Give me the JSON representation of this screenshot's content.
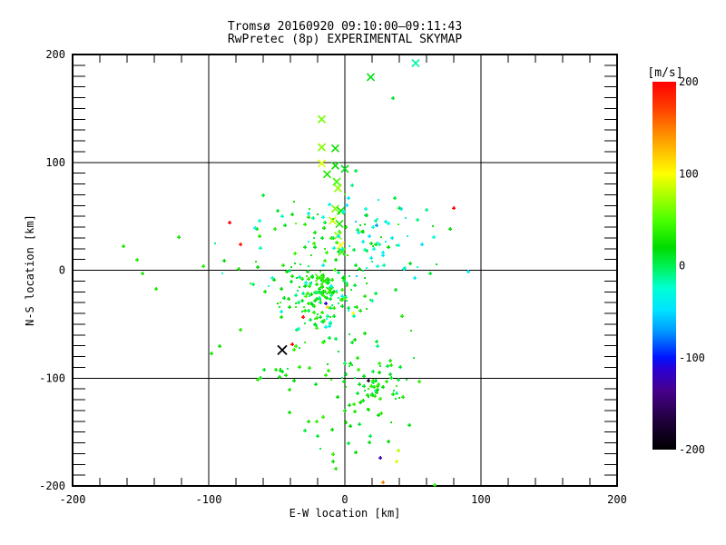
{
  "chart_data": {
    "type": "scatter",
    "title_line1": "Tromsø 20160920 09:10:00–09:11:43",
    "title_line2": "RwPretec (8p) EXPERIMENTAL SKYMAP",
    "xlabel": "E-W location [km]",
    "ylabel": "N-S location [km]",
    "xlim": [
      -200,
      200
    ],
    "ylim": [
      -200,
      200
    ],
    "xticks": [
      -200,
      -100,
      0,
      100,
      200
    ],
    "yticks": [
      -200,
      -100,
      0,
      100,
      200
    ],
    "x_minor_step": 20,
    "y_minor_step": 10,
    "grid": true,
    "axis_color": "#000000",
    "background": "#ffffff",
    "colorbar": {
      "label": "[m/s]",
      "min": -200,
      "max": 200,
      "ticks": [
        200,
        100,
        0,
        -100,
        -200
      ]
    },
    "colormap": [
      [
        0.0,
        "#000000"
      ],
      [
        0.08,
        "#20003c"
      ],
      [
        0.16,
        "#46008c"
      ],
      [
        0.22,
        "#2a00d4"
      ],
      [
        0.25,
        "#0014ff"
      ],
      [
        0.32,
        "#0096ff"
      ],
      [
        0.38,
        "#00e4ff"
      ],
      [
        0.44,
        "#00ffd2"
      ],
      [
        0.5,
        "#00f050"
      ],
      [
        0.55,
        "#00dc00"
      ],
      [
        0.62,
        "#46ff00"
      ],
      [
        0.72,
        "#d2ff00"
      ],
      [
        0.75,
        "#ffff00"
      ],
      [
        0.85,
        "#ff9600"
      ],
      [
        0.93,
        "#ff3c00"
      ],
      [
        1.0,
        "#ff0000"
      ]
    ],
    "markers": {
      "p": "small-plus-dot",
      "x": "cross",
      "X": "large-cross"
    },
    "points": [
      [
        52,
        192,
        -15,
        "x"
      ],
      [
        19,
        179,
        15,
        "x"
      ],
      [
        35,
        160,
        10,
        "p"
      ],
      [
        -17,
        140,
        60,
        "x"
      ],
      [
        -17,
        114,
        65,
        "x"
      ],
      [
        -7,
        113,
        25,
        "x"
      ],
      [
        -17,
        99,
        90,
        "x"
      ],
      [
        -7,
        97,
        20,
        "x"
      ],
      [
        0,
        94,
        15,
        "x"
      ],
      [
        -13,
        89,
        30,
        "x"
      ],
      [
        -6,
        82,
        45,
        "x"
      ],
      [
        -5,
        76,
        70,
        "x"
      ],
      [
        -7,
        57,
        60,
        "x"
      ],
      [
        -3,
        55,
        25,
        "x"
      ],
      [
        -1,
        54,
        -30,
        "p"
      ],
      [
        -9,
        46,
        85,
        "x"
      ],
      [
        -4,
        43,
        30,
        "x"
      ],
      [
        -5,
        32,
        70,
        "x"
      ],
      [
        -3,
        23,
        95,
        "x"
      ],
      [
        -2,
        17,
        40,
        "x"
      ],
      [
        -15,
        -10,
        30,
        "x"
      ],
      [
        -11,
        -19,
        25,
        "x"
      ],
      [
        -19,
        -7,
        40,
        "x"
      ],
      [
        -46,
        -74,
        -195,
        "X"
      ],
      [
        -39,
        -69,
        200,
        "p"
      ],
      [
        -31,
        -43,
        195,
        "p"
      ],
      [
        -85,
        44,
        200,
        "p"
      ],
      [
        -77,
        24,
        190,
        "p"
      ],
      [
        80,
        58,
        200,
        "p"
      ],
      [
        -14,
        -31,
        -120,
        "p"
      ],
      [
        17,
        -102,
        -170,
        "p"
      ],
      [
        26,
        -174,
        -130,
        "p"
      ],
      [
        28,
        -197,
        150,
        "p"
      ],
      [
        -13,
        -34,
        120,
        "p"
      ],
      [
        6,
        -40,
        100,
        "p"
      ],
      [
        23,
        42,
        -70,
        "p"
      ],
      [
        77,
        38,
        20,
        "p"
      ],
      [
        66,
        -199,
        30,
        "p"
      ],
      [
        38,
        -177,
        90,
        "p"
      ],
      [
        39,
        -167,
        80,
        "p"
      ],
      [
        -9,
        -177,
        25,
        "p"
      ],
      [
        -7,
        -184,
        30,
        "p"
      ],
      [
        8,
        -169,
        20,
        "p"
      ],
      [
        1,
        -141,
        25,
        "p"
      ],
      [
        4,
        -144,
        20,
        "p"
      ],
      [
        7,
        -131,
        30,
        "p"
      ],
      [
        -41,
        -132,
        25,
        "p"
      ],
      [
        -41,
        -111,
        30,
        "p"
      ],
      [
        -163,
        22,
        30,
        "p"
      ],
      [
        -153,
        10,
        32,
        "p"
      ],
      [
        -149,
        -3,
        28,
        "p"
      ],
      [
        -139,
        -17,
        30,
        "p"
      ],
      [
        -122,
        31,
        28,
        "p"
      ],
      [
        -104,
        4,
        35,
        "p"
      ],
      [
        -78,
        1,
        30,
        "p"
      ],
      [
        -92,
        -70,
        25,
        "p"
      ],
      [
        -98,
        -77,
        28,
        "p"
      ],
      [
        -63,
        46,
        -25,
        "p"
      ],
      [
        -65,
        38,
        25,
        "p"
      ],
      [
        -63,
        32,
        30,
        "p"
      ],
      [
        -62,
        21,
        -20,
        "p"
      ]
    ],
    "clusters": [
      {
        "n": 150,
        "cx": -17,
        "cy": -22,
        "sx": 16,
        "sy": 20,
        "v": [
          [
            0,
            45,
            0.78
          ],
          [
            -35,
            -5,
            0.22
          ]
        ]
      },
      {
        "n": 75,
        "cx": -20,
        "cy": -12,
        "sx": 36,
        "sy": 40,
        "v": [
          [
            0,
            40,
            0.75
          ],
          [
            -40,
            -5,
            0.25
          ]
        ]
      },
      {
        "n": 70,
        "cx": 22,
        "cy": -108,
        "sx": 14,
        "sy": 16,
        "v": [
          [
            0,
            40,
            0.88
          ],
          [
            -25,
            -5,
            0.12
          ]
        ]
      },
      {
        "n": 42,
        "cx": 22,
        "cy": 26,
        "sx": 13,
        "sy": 15,
        "v": [
          [
            -60,
            -12,
            0.78
          ],
          [
            5,
            30,
            0.22
          ]
        ]
      },
      {
        "n": 28,
        "cx": -18,
        "cy": 44,
        "sx": 24,
        "sy": 13,
        "v": [
          [
            0,
            50,
            0.6
          ],
          [
            -45,
            -10,
            0.4
          ]
        ]
      },
      {
        "n": 20,
        "cx": -45,
        "cy": -96,
        "sx": 20,
        "sy": 8,
        "v": [
          [
            5,
            40,
            1
          ]
        ]
      },
      {
        "n": 10,
        "cx": -8,
        "cy": -152,
        "sx": 16,
        "sy": 14,
        "v": [
          [
            0,
            40,
            1
          ]
        ]
      },
      {
        "n": 8,
        "cx": 55,
        "cy": 12,
        "sx": 16,
        "sy": 14,
        "v": [
          [
            -50,
            -10,
            0.6
          ],
          [
            5,
            30,
            0.4
          ]
        ]
      }
    ],
    "seed": 20160920
  }
}
